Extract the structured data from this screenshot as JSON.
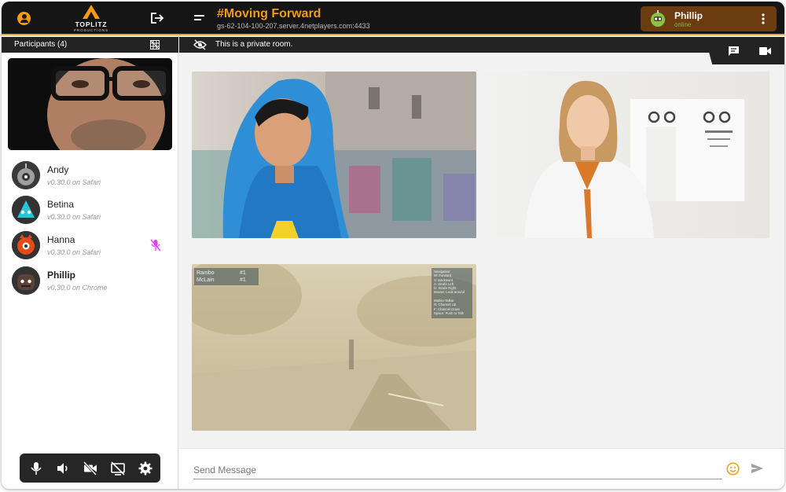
{
  "colors": {
    "accent": "#f39c12",
    "online": "#6cc04a",
    "muted": "#e040fb"
  },
  "header": {
    "logo_text": "TOPLITZ",
    "logo_sub": "PRODUCTIONS",
    "room_title": "#Moving Forward",
    "room_server": "gs-62-104-100-207.server.4netplayers.com:4433",
    "user_name": "Phillip",
    "user_status": "online"
  },
  "sidebar": {
    "participants_label": "Participants (4)",
    "participants": [
      {
        "name": "Andy",
        "meta": "v0.30.0 on Safari",
        "muted": false
      },
      {
        "name": "Betina",
        "meta": "v0.30.0 on Safari",
        "muted": false
      },
      {
        "name": "Hanna",
        "meta": "v0.30.0 on Safari",
        "muted": true
      },
      {
        "name": "Phillip",
        "meta": "v0.30.0 on Chrome",
        "muted": false
      }
    ]
  },
  "room": {
    "privacy_text": "This is a private room."
  },
  "game_hud": {
    "players": [
      {
        "name": "Rambo",
        "rank": "#1"
      },
      {
        "name": "McLain",
        "rank": "#1"
      }
    ],
    "help_lines": [
      "Navigation:",
      "W: Forward",
      "S: Backward",
      "A: Strafe Left",
      "D: Strafe Right",
      "Mouse: Look around",
      "",
      "Walkie-Talkie:",
      "R: Channel Up",
      "F: Channel Down",
      "Space: Push to Talk"
    ]
  },
  "message": {
    "placeholder": "Send Message"
  },
  "icons": [
    "user-circle-icon",
    "logout-icon",
    "menu-icon",
    "more-vert-icon",
    "grid-icon",
    "eye-off-icon",
    "chat-icon",
    "videocam-icon",
    "mic-icon",
    "volume-icon",
    "videocam-off-icon",
    "screen-share-off-icon",
    "settings-icon",
    "mic-off-icon",
    "emoji-icon",
    "send-icon"
  ]
}
